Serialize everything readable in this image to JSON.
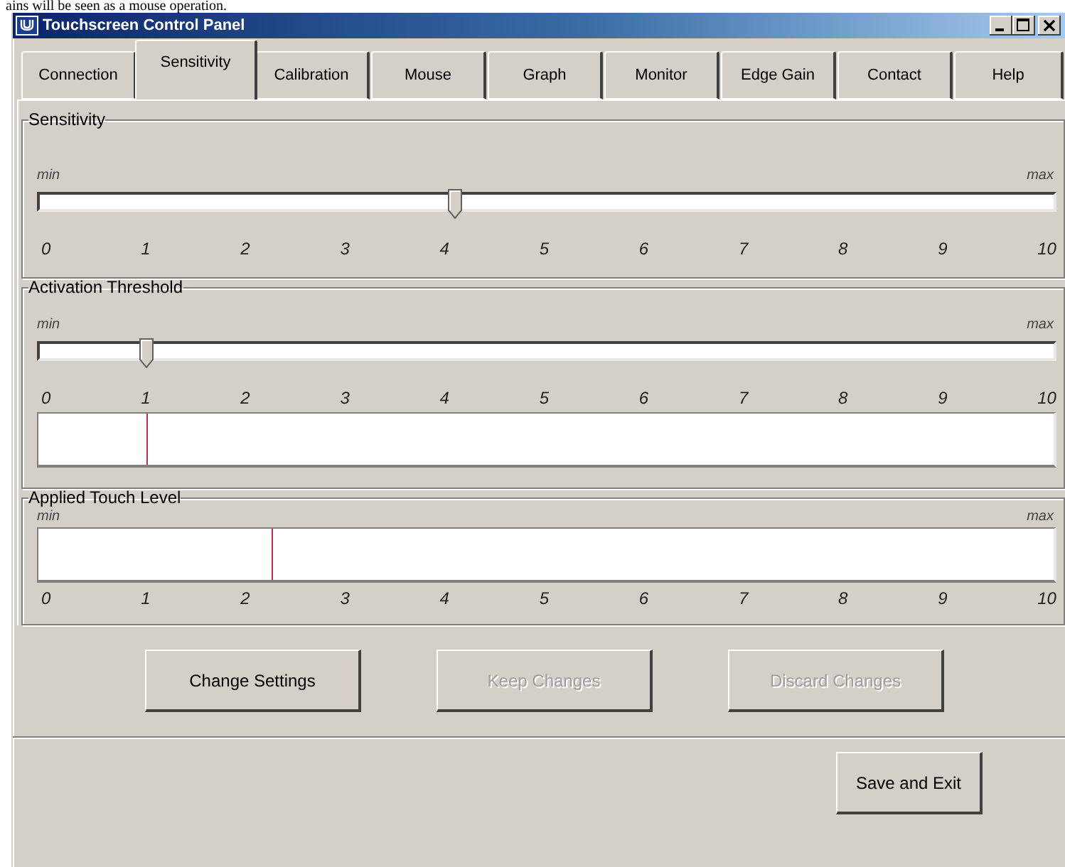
{
  "document_text": "ains will be seen as a mouse operation.",
  "window": {
    "title": "Touchscreen Control Panel"
  },
  "tabs": [
    {
      "label": "Connection",
      "selected": false
    },
    {
      "label": "Sensitivity",
      "selected": true
    },
    {
      "label": "Calibration",
      "selected": false
    },
    {
      "label": "Mouse",
      "selected": false
    },
    {
      "label": "Graph",
      "selected": false
    },
    {
      "label": "Monitor",
      "selected": false
    },
    {
      "label": "Edge Gain",
      "selected": false
    },
    {
      "label": "Contact",
      "selected": false
    },
    {
      "label": "Help",
      "selected": false
    }
  ],
  "groups": [
    {
      "title": "Sensitivity",
      "kind": "slider",
      "min_label": "min",
      "max_label": "max",
      "slider": {
        "level": 0.41
      },
      "ticks": [
        "0",
        "1",
        "2",
        "3",
        "4",
        "5",
        "6",
        "7",
        "8",
        "9",
        "10"
      ]
    },
    {
      "title": "Activation Threshold",
      "kind": "slider_meter",
      "min_label": "min",
      "max_label": "max",
      "slider": {
        "level": 0.105
      },
      "meter": {
        "level": 0.107
      },
      "ticks": [
        "0",
        "1",
        "2",
        "3",
        "4",
        "5",
        "6",
        "7",
        "8",
        "9",
        "10"
      ]
    },
    {
      "title": "Applied Touch Level",
      "kind": "meter",
      "min_label": "min",
      "max_label": "max",
      "meter": {
        "level": 0.23
      },
      "ticks": [
        "0",
        "1",
        "2",
        "3",
        "4",
        "5",
        "6",
        "7",
        "8",
        "9",
        "10"
      ]
    }
  ],
  "buttons": [
    {
      "label": "Change Settings",
      "disabled": false
    },
    {
      "label": "Keep Changes",
      "disabled": true
    },
    {
      "label": "Discard Changes",
      "disabled": true
    }
  ],
  "footer_button": {
    "label": "Save and Exit"
  }
}
